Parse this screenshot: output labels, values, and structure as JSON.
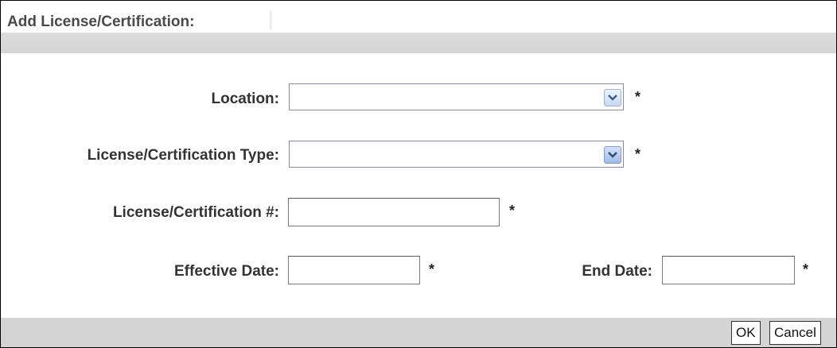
{
  "dialog": {
    "title": "Add License/Certification:"
  },
  "form": {
    "location": {
      "label": "Location:",
      "value": "",
      "required_mark": "*"
    },
    "license_type": {
      "label": "License/Certification Type:",
      "value": "",
      "required_mark": "*"
    },
    "license_number": {
      "label": "License/Certification #:",
      "value": "",
      "required_mark": "*"
    },
    "effective_date": {
      "label": "Effective Date:",
      "value": "",
      "required_mark": "*"
    },
    "end_date": {
      "label": "End Date:",
      "value": "",
      "required_mark": "*"
    }
  },
  "footer": {
    "ok_label": "OK",
    "cancel_label": "Cancel"
  },
  "icons": {
    "dropdown": "chevron-down-icon"
  },
  "colors": {
    "header_band": "#dcdcdc",
    "footer_band": "#d4d4d4",
    "dropdown_button": "#c8d8f2"
  }
}
